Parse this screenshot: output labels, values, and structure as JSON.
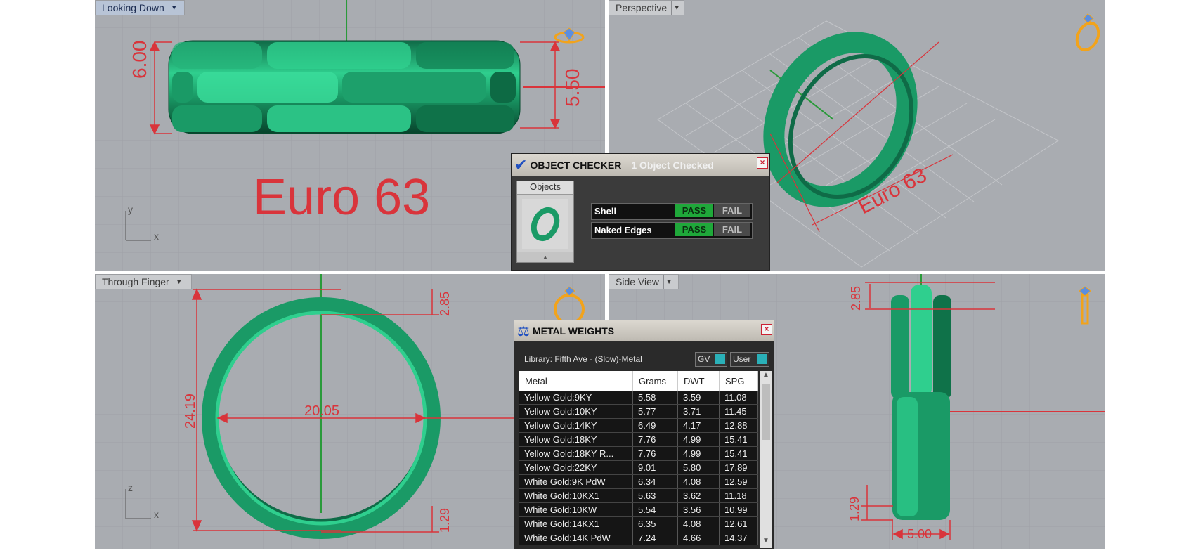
{
  "viewports": {
    "top": {
      "label": "Looking Down",
      "dim_height": "6.00",
      "dim_inner": "5.50",
      "size_label": "Euro 63",
      "axis_a": "y",
      "axis_b": "x"
    },
    "perspective": {
      "label": "Perspective",
      "size_label": "Euro 63"
    },
    "front": {
      "label": "Through Finger",
      "dim_outer": "24.19",
      "dim_inner": "20.05",
      "dim_top": "2.85",
      "dim_bottom": "1.29",
      "axis_a": "z",
      "axis_b": "x"
    },
    "side": {
      "label": "Side View",
      "dim_top": "2.85",
      "dim_bottom": "1.29",
      "dim_width": "5.00"
    }
  },
  "object_checker": {
    "title": "OBJECT CHECKER",
    "status": "1  Object Checked",
    "objects_label": "Objects",
    "rows": [
      {
        "label": "Shell",
        "pass": "PASS",
        "fail": "FAIL"
      },
      {
        "label": "Naked Edges",
        "pass": "PASS",
        "fail": "FAIL"
      }
    ]
  },
  "metal_weights": {
    "title": "METAL WEIGHTS",
    "library": "Library: Fifth Ave - (Slow)-Metal",
    "toggle_gv": "GV",
    "toggle_user": "User",
    "columns": [
      "Metal",
      "Grams",
      "DWT",
      "SPG"
    ],
    "rows": [
      [
        "Yellow Gold:9KY",
        "5.58",
        "3.59",
        "11.08"
      ],
      [
        "Yellow Gold:10KY",
        "5.77",
        "3.71",
        "11.45"
      ],
      [
        "Yellow Gold:14KY",
        "6.49",
        "4.17",
        "12.88"
      ],
      [
        "Yellow Gold:18KY",
        "7.76",
        "4.99",
        "15.41"
      ],
      [
        "Yellow Gold:18KY R...",
        "7.76",
        "4.99",
        "15.41"
      ],
      [
        "Yellow Gold:22KY",
        "9.01",
        "5.80",
        "17.89"
      ],
      [
        "White Gold:9K PdW",
        "6.34",
        "4.08",
        "12.59"
      ],
      [
        "White Gold:10KX1",
        "5.63",
        "3.62",
        "11.18"
      ],
      [
        "White Gold:10KW",
        "5.54",
        "3.56",
        "10.99"
      ],
      [
        "White Gold:14KX1",
        "6.35",
        "4.08",
        "12.61"
      ],
      [
        "White Gold:14K PdW",
        "7.24",
        "4.66",
        "14.37"
      ]
    ]
  },
  "colors": {
    "ring": "#1f9a6a",
    "dimension": "#d9343b",
    "gizmo": "#f2a31b"
  }
}
